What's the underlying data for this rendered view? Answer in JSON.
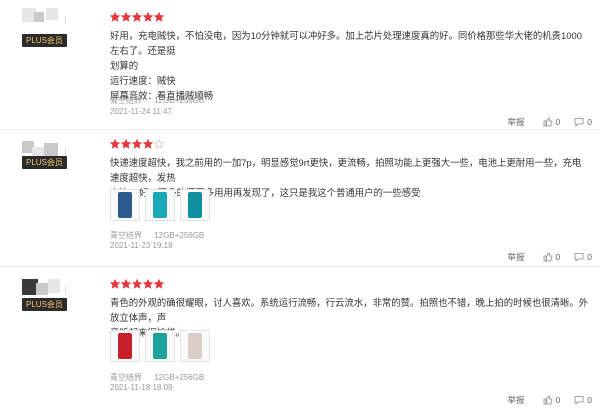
{
  "reviews": [
    {
      "badge": "PLUS会员",
      "rating": 5,
      "lines": [
        "好用，充电贼快，不怕没电，因为10分钟就可以冲好多。加上芯片处理速度真的好。同价格那些华大佬的机贵1000左右了。还是挺",
        "划算的",
        "运行速度：贼快",
        "屏幕音效：看直播贼顺畅"
      ],
      "meta": [
        "青空结界",
        "12GB+256GB"
      ],
      "date": "2021-11-24 11:47",
      "report": "举报",
      "likes": "0",
      "comments": "0",
      "thumbs": []
    },
    {
      "badge": "PLUS会员",
      "rating": 4,
      "lines": [
        "快递速度超快，我之前用的一加7p，明显感觉9rt更快，更流畅，拍照功能上更强大一些，电池上更耐用一些，充电速度超快，发热",
        "上比7p好，更多的还要多用用再发现了，这只是我这个普通用户的一些感受"
      ],
      "meta": [
        "青空结界",
        "12GB+256GB"
      ],
      "date": "2021-11-23 19:18",
      "report": "举报",
      "likes": "0",
      "comments": "0",
      "thumbs": [
        "#2a5a8f",
        "#1aa7b8",
        "#0f8fa0"
      ]
    },
    {
      "badge": "PLUS会员",
      "rating": 5,
      "lines": [
        "青色的外观的确很耀眼，讨人喜欢。系统运行流畅，行云流水，非常的赞。拍照也不错，晚上拍的时候也很清晰。外放立体声，声",
        "音听起来很愉悦。"
      ],
      "meta": [
        "青空结界",
        "12GB+256GB"
      ],
      "date": "2021-11-18 18:09",
      "report": "举报",
      "likes": "0",
      "comments": "0",
      "thumbs": [
        "#c8202a",
        "#1aa39a",
        "#d9cfc8"
      ]
    }
  ]
}
